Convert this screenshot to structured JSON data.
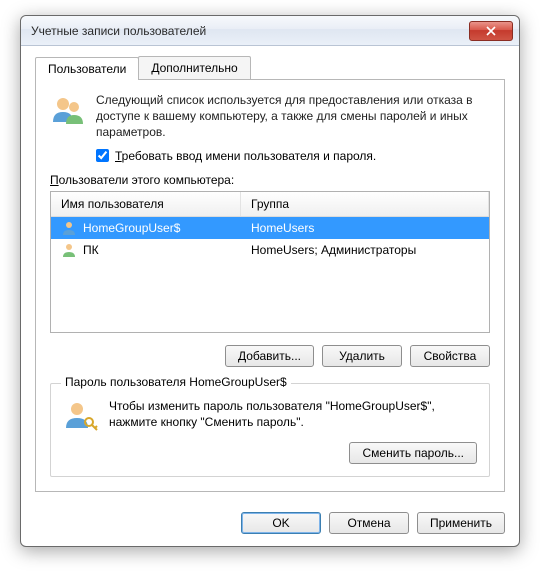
{
  "window": {
    "title": "Учетные записи пользователей"
  },
  "tabs": {
    "users": "Пользователи",
    "advanced": "Дополнительно"
  },
  "intro": "Следующий список используется для предоставления или отказа в доступе к вашему компьютеру, а также для смены паролей и иных параметров.",
  "require_label_pre": "Т",
  "require_label_post": "ребовать ввод имени пользователя и пароля.",
  "require_checked": true,
  "list_label_pre": "П",
  "list_label_post": "ользователи этого компьютера:",
  "columns": {
    "name": "Имя пользователя",
    "group": "Группа"
  },
  "rows": [
    {
      "name": "HomeGroupUser$",
      "group": "HomeUsers",
      "selected": true
    },
    {
      "name": "ПК",
      "group": "HomeUsers; Администраторы",
      "selected": false
    }
  ],
  "buttons": {
    "add": "Добавить...",
    "remove": "Удалить",
    "props": "Свойства",
    "change_pw": "Сменить пароль...",
    "ok": "OK",
    "cancel": "Отмена",
    "apply": "Применить"
  },
  "pw_group_title": "Пароль пользователя HomeGroupUser$",
  "pw_text": "Чтобы изменить пароль пользователя \"HomeGroupUser$\", нажмите кнопку \"Сменить пароль\"."
}
